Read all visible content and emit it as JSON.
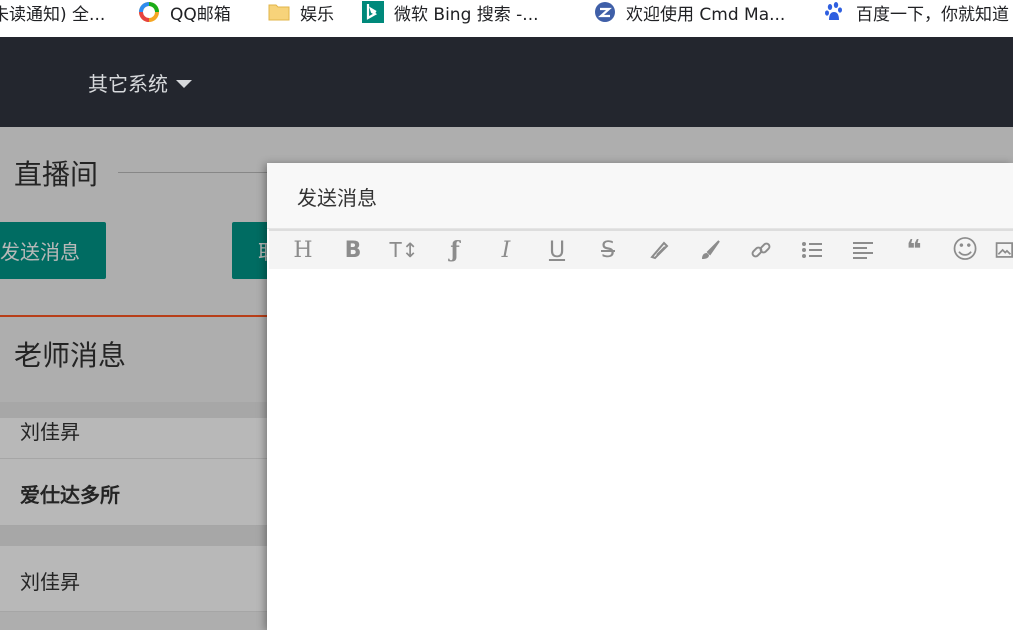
{
  "bookmarks": [
    {
      "label": "未读通知) 全...",
      "icon": "notice-icon"
    },
    {
      "label": "QQ邮箱",
      "icon": "qq-mail-icon"
    },
    {
      "label": "娱乐",
      "icon": "folder-icon"
    },
    {
      "label": "微软 Bing 搜索 -...",
      "icon": "bing-icon"
    },
    {
      "label": "欢迎使用 Cmd Ma...",
      "icon": "cmd-markdown-icon"
    },
    {
      "label": "百度一下，你就知道",
      "icon": "baidu-paw-icon"
    }
  ],
  "nav": {
    "other_systems": "其它系统"
  },
  "page": {
    "live_title": "直播间",
    "send_button": "发送消息",
    "second_button": "取",
    "teacher_title": "老师消息",
    "messages": [
      "刘佳昇",
      "爱仕达多所",
      "刘佳昇"
    ]
  },
  "modal": {
    "title": "发送消息",
    "toolbar": [
      "heading-icon",
      "bold-icon",
      "font-size-icon",
      "font-family-icon",
      "italic-icon",
      "underline-icon",
      "strikethrough-icon",
      "highlighter-icon",
      "brush-icon",
      "link-icon",
      "bullet-list-icon",
      "align-left-icon",
      "quote-icon",
      "emoji-icon",
      "image-icon"
    ],
    "toolbar_glyphs": [
      "H",
      "B",
      "T↕",
      "ƒ",
      "I",
      "U",
      "S",
      "⁄⁄",
      "🖌",
      "🔗",
      "☰",
      "≡",
      "❝",
      "☺",
      "▣"
    ]
  },
  "colors": {
    "accent_teal": "#009688",
    "accent_orange": "#FF5722",
    "nav_bg": "#23262e"
  }
}
